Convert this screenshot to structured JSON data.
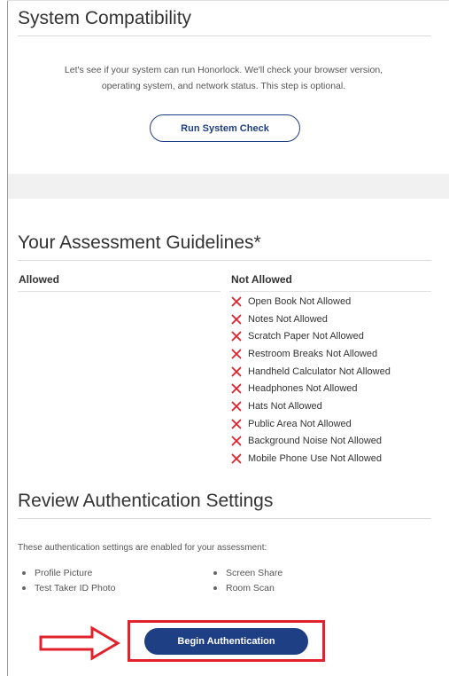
{
  "system_check": {
    "title": "System Compatibility",
    "description_line1": "Let's see if your system can run Honorlock. We'll check your browser version,",
    "description_line2": "operating system, and network status. This step is optional.",
    "button_label": "Run System Check"
  },
  "guidelines": {
    "title": "Your Assessment Guidelines*",
    "allowed_header": "Allowed",
    "not_allowed_header": "Not Allowed",
    "not_allowed_items": [
      "Open Book Not Allowed",
      "Notes Not Allowed",
      "Scratch Paper Not Allowed",
      "Restroom Breaks Not Allowed",
      "Handheld Calculator Not Allowed",
      "Headphones Not Allowed",
      "Hats Not Allowed",
      "Public Area Not Allowed",
      "Background Noise Not Allowed",
      "Mobile Phone Use Not Allowed"
    ],
    "icon": "red-x-icon",
    "icon_color": "#e1212b"
  },
  "authentication": {
    "title": "Review Authentication Settings",
    "description": "These authentication settings are enabled for your assessment:",
    "settings_left": [
      "Profile Picture",
      "Test Taker ID Photo"
    ],
    "settings_right": [
      "Screen Share",
      "Room Scan"
    ],
    "button_label": "Begin Authentication"
  },
  "colors": {
    "primary": "#1f3f85",
    "highlight": "#e1212b"
  }
}
